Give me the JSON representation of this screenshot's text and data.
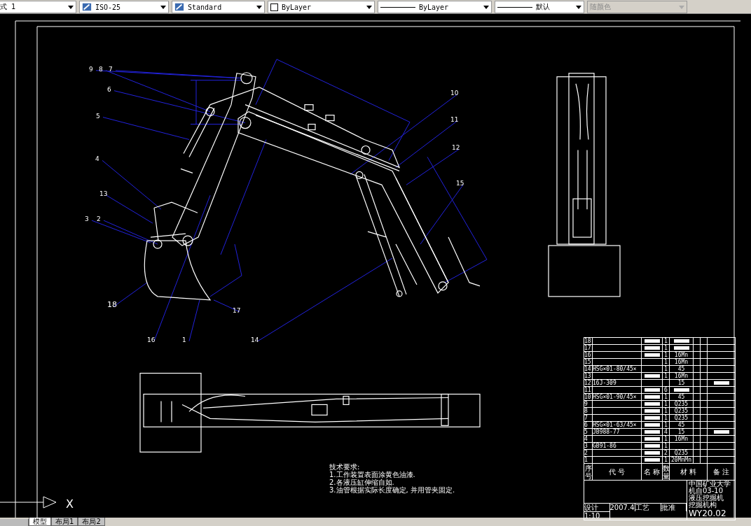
{
  "toolbar": {
    "items": [
      {
        "kind": "combo",
        "value": "式 1",
        "icon": false
      },
      {
        "kind": "combo",
        "value": "ISO-25",
        "icon": true
      },
      {
        "kind": "combo",
        "value": "Standard",
        "icon": true
      },
      {
        "kind": "layer",
        "value": "ByLayer"
      },
      {
        "kind": "line",
        "value": "ByLayer"
      },
      {
        "kind": "line",
        "value": "默认"
      },
      {
        "kind": "disabled",
        "value": "随颜色"
      }
    ]
  },
  "drawing": {
    "balloons": [
      "9",
      "8",
      "7",
      "6",
      "5",
      "4",
      "13",
      "3",
      "2",
      "18",
      "16",
      "1",
      "14",
      "17",
      "10",
      "11",
      "12",
      "15"
    ],
    "requirements": {
      "title": "技术要求:",
      "lines": [
        "1.工作装置表面涂黄色油漆.",
        "2.各液压缸伸缩自如.",
        "3.油管根据实际长度确定, 并用管夹固定."
      ]
    },
    "parts_list": {
      "rows": [
        {
          "no": "18",
          "code": "",
          "name_block": true,
          "qty": "1",
          "material": "",
          "material_block": true,
          "note_block": false
        },
        {
          "no": "17",
          "code": "",
          "name_block": true,
          "qty": "1",
          "material": "",
          "material_block": true,
          "note_block": false
        },
        {
          "no": "16",
          "code": "",
          "name_block": true,
          "qty": "1",
          "material": "16Mn",
          "material_block": false,
          "note_block": false
        },
        {
          "no": "15",
          "code": "",
          "name_block": false,
          "qty": "1",
          "material": "16Mn",
          "material_block": false,
          "note_block": false
        },
        {
          "no": "14",
          "code": "HSG×01-80/45×",
          "name_block": false,
          "qty": "1",
          "material": "45",
          "material_block": false,
          "note_block": false
        },
        {
          "no": "13",
          "code": "",
          "name_block": true,
          "qty": "1",
          "material": "16Mn",
          "material_block": false,
          "note_block": false
        },
        {
          "no": "12",
          "code": "16J-309",
          "name_block": false,
          "qty": "",
          "material": "15",
          "material_block": false,
          "note_block": true
        },
        {
          "no": "11",
          "code": "",
          "name_block": true,
          "qty": "6",
          "material": "",
          "material_block": true,
          "note_block": false
        },
        {
          "no": "10",
          "code": "HSG×01-90/45×",
          "name_block": true,
          "qty": "1",
          "material": "45",
          "material_block": false,
          "note_block": false
        },
        {
          "no": "9",
          "code": "",
          "name_block": true,
          "qty": "1",
          "material": "Q235",
          "material_block": false,
          "note_block": false
        },
        {
          "no": "8",
          "code": "",
          "name_block": true,
          "qty": "1",
          "material": "Q235",
          "material_block": false,
          "note_block": false
        },
        {
          "no": "7",
          "code": "",
          "name_block": true,
          "qty": "1",
          "material": "Q235",
          "material_block": false,
          "note_block": false
        },
        {
          "no": "6",
          "code": "HSG×01-63/45×",
          "name_block": true,
          "qty": "1",
          "material": "45",
          "material_block": false,
          "note_block": false
        },
        {
          "no": "5",
          "code": "JB988-77",
          "name_block": true,
          "qty": "4",
          "material": "15",
          "material_block": false,
          "note_block": true
        },
        {
          "no": "4",
          "code": "",
          "name_block": true,
          "qty": "1",
          "material": "16Mn",
          "material_block": false,
          "note_block": false
        },
        {
          "no": "3",
          "code": "GB91-86",
          "name_block": true,
          "qty": "1",
          "material": "",
          "material_block": false,
          "note_block": false
        },
        {
          "no": "2",
          "code": "",
          "name_block": true,
          "qty": "2",
          "material": "Q235",
          "material_block": false,
          "note_block": false
        },
        {
          "no": "1",
          "code": "",
          "name_block": true,
          "qty": "1",
          "material": "20MnMn",
          "material_block": false,
          "note_block": false
        }
      ],
      "header": [
        "序号",
        "代 号",
        "名 称",
        "数量",
        "材 料",
        "备 注"
      ]
    },
    "title_block": {
      "school": "中国矿业大学",
      "class": "机自03-10",
      "title": "液压挖掘机",
      "subtitle": "挖掘机构",
      "scale": "1:10",
      "drawing_no": "WY20.02",
      "labels": [
        "设计",
        "2007.4",
        "工艺",
        "批准"
      ]
    },
    "axis_label": "X"
  },
  "layout_tabs": [
    {
      "label": "模型",
      "selected": true
    },
    {
      "label": "布局1",
      "selected": false
    },
    {
      "label": "布局2",
      "selected": false
    }
  ]
}
